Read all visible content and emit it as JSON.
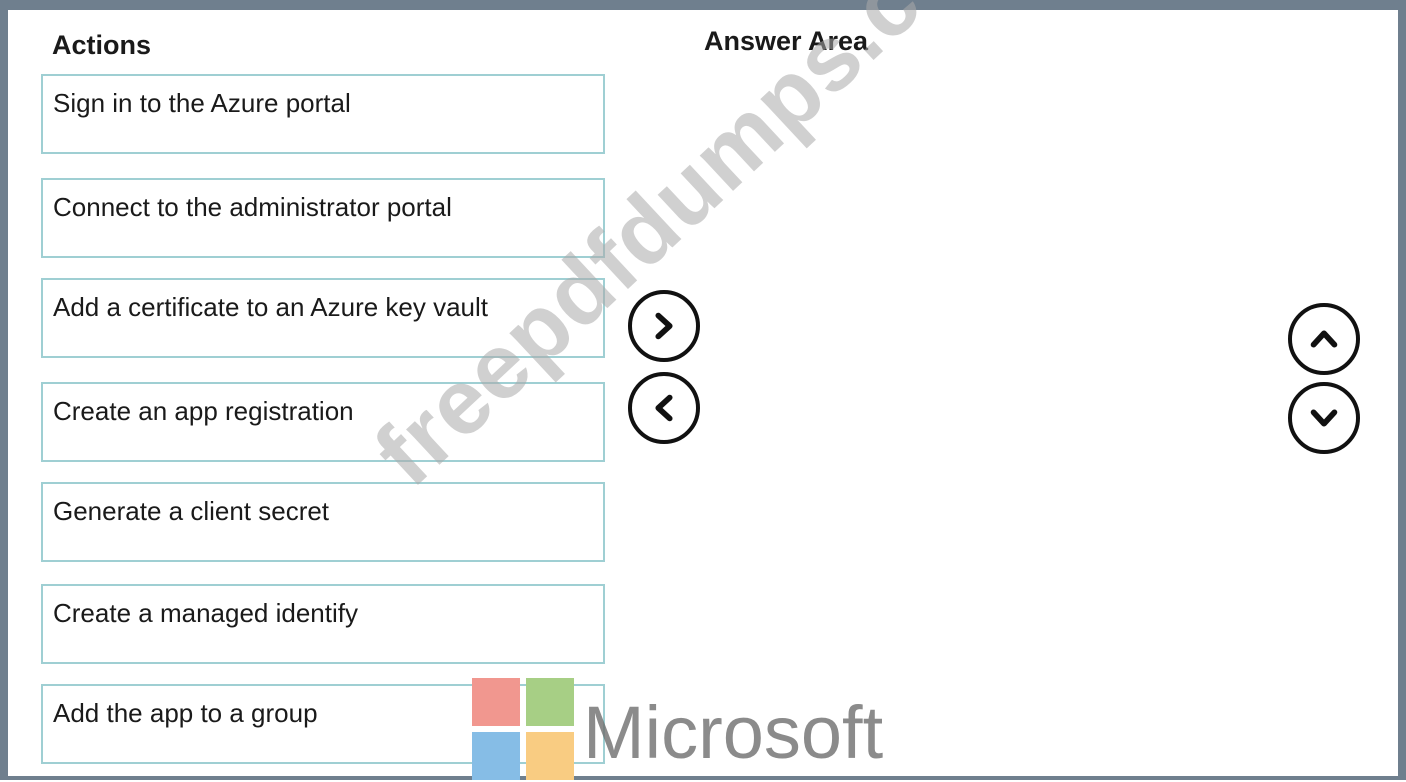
{
  "headings": {
    "actions": "Actions",
    "answer_area": "Answer Area"
  },
  "actions": [
    "Sign in to the Azure portal",
    "Connect to the administrator portal",
    "Add a certificate to an Azure key vault",
    "Create an app registration",
    "Generate a client secret",
    "Create a managed identify",
    "Add the app to a group"
  ],
  "watermark": {
    "text": "freepdfdumps.com"
  },
  "logo": {
    "wordmark": "Microsoft",
    "colors": [
      "#f1978f",
      "#a7cf85",
      "#86bde6",
      "#f9cc82"
    ]
  },
  "icons": {
    "move_right": "chevron-right-icon",
    "move_left": "chevron-left-icon",
    "move_up": "chevron-up-icon",
    "move_down": "chevron-down-icon"
  },
  "colors": {
    "frame": "#6f7f8e",
    "action_border": "#9fcfd3"
  }
}
